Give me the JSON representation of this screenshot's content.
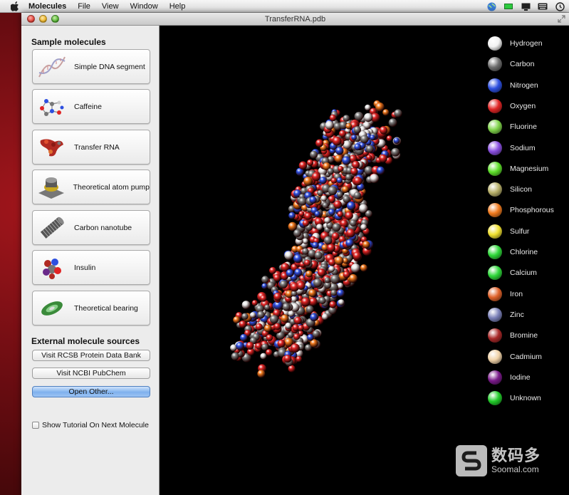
{
  "menubar": {
    "app_name": "Molecules",
    "items": [
      "File",
      "View",
      "Window",
      "Help"
    ]
  },
  "window": {
    "title": "TransferRNA.pdb"
  },
  "sidebar": {
    "sample_title": "Sample molecules",
    "molecules": [
      {
        "label": "Simple DNA segment",
        "icon": "dna-thumbnail-icon"
      },
      {
        "label": "Caffeine",
        "icon": "caffeine-thumbnail-icon"
      },
      {
        "label": "Transfer RNA",
        "icon": "transfer-rna-thumbnail-icon"
      },
      {
        "label": "Theoretical atom pump",
        "icon": "atom-pump-thumbnail-icon"
      },
      {
        "label": "Carbon nanotube",
        "icon": "nanotube-thumbnail-icon"
      },
      {
        "label": "Insulin",
        "icon": "insulin-thumbnail-icon"
      },
      {
        "label": "Theoretical bearing",
        "icon": "bearing-thumbnail-icon"
      }
    ],
    "external_title": "External molecule sources",
    "rcsb_label": "Visit RCSB Protein Data Bank",
    "ncbi_label": "Visit NCBI PubChem",
    "open_other_label": "Open Other...",
    "tutorial_label": "Show Tutorial On Next Molecule"
  },
  "legend": [
    {
      "label": "Hydrogen",
      "color": "#f2f2f2"
    },
    {
      "label": "Carbon",
      "color": "#6e6e6e"
    },
    {
      "label": "Nitrogen",
      "color": "#2d4fe0"
    },
    {
      "label": "Oxygen",
      "color": "#e02525"
    },
    {
      "label": "Fluorine",
      "color": "#7fd34a"
    },
    {
      "label": "Sodium",
      "color": "#8a4fe0"
    },
    {
      "label": "Magnesium",
      "color": "#5ee02a"
    },
    {
      "label": "Silicon",
      "color": "#b8b06a"
    },
    {
      "label": "Phosphorous",
      "color": "#f07a1e"
    },
    {
      "label": "Sulfur",
      "color": "#f0e030"
    },
    {
      "label": "Chlorine",
      "color": "#2fd83a"
    },
    {
      "label": "Calcium",
      "color": "#2fd83a"
    },
    {
      "label": "Iron",
      "color": "#e0622a"
    },
    {
      "label": "Zinc",
      "color": "#7a80b8"
    },
    {
      "label": "Bromine",
      "color": "#a82828"
    },
    {
      "label": "Cadmium",
      "color": "#f0d2a8"
    },
    {
      "label": "Iodine",
      "color": "#7a1a8a"
    },
    {
      "label": "Unknown",
      "color": "#22cc2a"
    }
  ],
  "watermark": {
    "cn": "数码多",
    "en": "Soomal.com"
  }
}
